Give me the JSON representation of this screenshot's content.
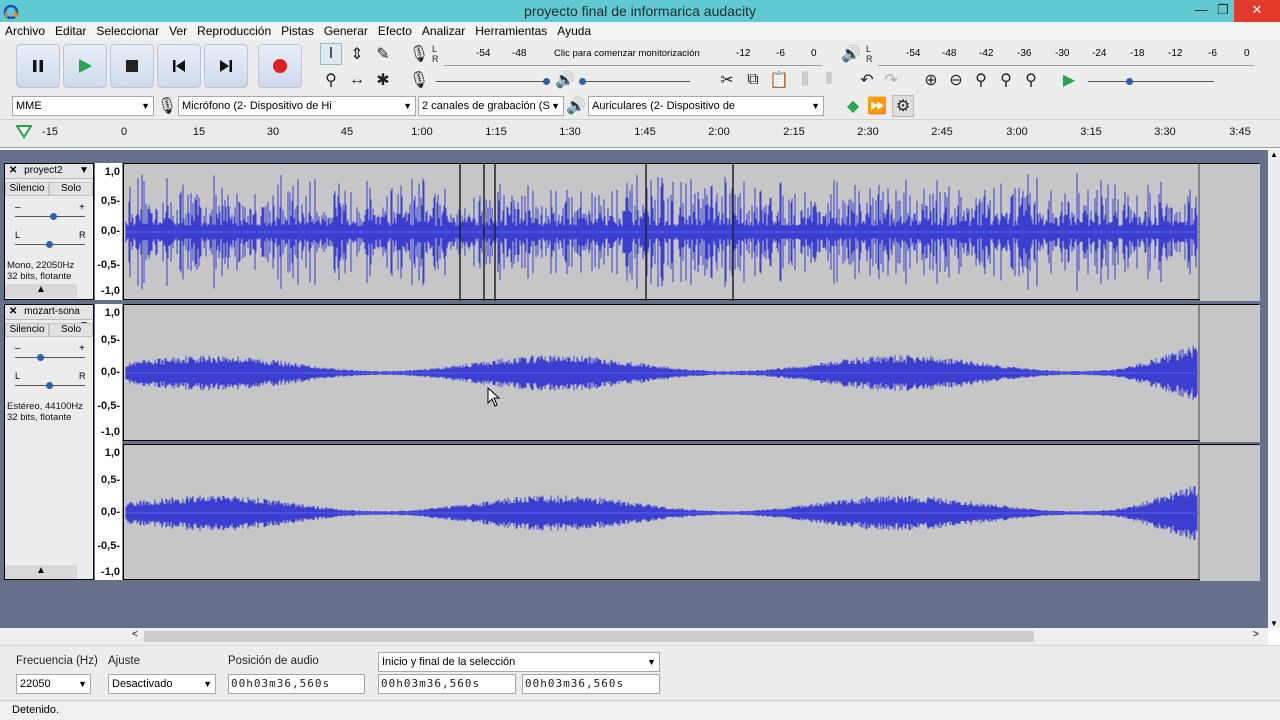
{
  "window": {
    "title": "proyecto final de informarica audacity",
    "minimize": "—",
    "maximize": "❐",
    "close": "✕"
  },
  "menu": [
    "Archivo",
    "Editar",
    "Seleccionar",
    "Ver",
    "Reproducción",
    "Pistas",
    "Generar",
    "Efecto",
    "Analizar",
    "Herramientas",
    "Ayuda"
  ],
  "meters": {
    "record_ticks": [
      "-54",
      "-48",
      "-12",
      "-6",
      "0"
    ],
    "record_hint": "Clic para comenzar monitorización",
    "play_ticks": [
      "-54",
      "-48",
      "-42",
      "-36",
      "-30",
      "-24",
      "-18",
      "-12",
      "-6",
      "0"
    ],
    "lr": [
      "L",
      "R"
    ]
  },
  "devices": {
    "host": "MME",
    "mic": "Micrófono (2- Dispositivo de Hi",
    "channels": "2 canales de grabación (S",
    "output": "Auriculares (2- Dispositivo de"
  },
  "ruler_ticks": [
    "-15",
    "0",
    "15",
    "30",
    "45",
    "1:00",
    "1:15",
    "1:30",
    "1:45",
    "2:00",
    "2:15",
    "2:30",
    "2:45",
    "3:00",
    "3:15",
    "3:30",
    "3:45"
  ],
  "tracks": [
    {
      "name": "proyect2",
      "mute": "Silencio",
      "solo": "Solo",
      "gain_minus": "–",
      "gain_plus": "+",
      "pan_l": "L",
      "pan_r": "R",
      "info1": "Mono, 22050Hz",
      "info2": "32 bits, flotante",
      "scale": [
        "1,0",
        "0,5-",
        "0,0-",
        "-0,5-",
        "-1,0"
      ]
    },
    {
      "name": "mozart-sona",
      "mute": "Silencio",
      "solo": "Solo",
      "gain_minus": "–",
      "gain_plus": "+",
      "pan_l": "L",
      "pan_r": "R",
      "info1": "Estéreo, 44100Hz",
      "info2": "32 bits, flotante",
      "scale": [
        "1,0",
        "0,5-",
        "0,0-",
        "-0,5-",
        "-1,0"
      ],
      "scale2": [
        "1,0",
        "0,5-",
        "0,0-",
        "-0,5-",
        "-1,0"
      ]
    }
  ],
  "selection": {
    "rate_label": "Frecuencia (Hz)",
    "rate_value": "22050",
    "snap_label": "Ajuste",
    "snap_value": "Desactivado",
    "pos_label": "Posición de audio",
    "pos_value": "00h03m36,560s",
    "range_label": "Inicio y final de la selección",
    "start_value": "00h03m36,560s",
    "end_value": "00h03m36,560s"
  },
  "status": "Detenido.",
  "colors": {
    "titlebar": "#60c9d1",
    "waveform": "#3a3fd0",
    "track_bg": "#c6c6c6",
    "trackarea_bg": "#67708a",
    "record_red": "#e02020",
    "play_green": "#23a84a"
  }
}
